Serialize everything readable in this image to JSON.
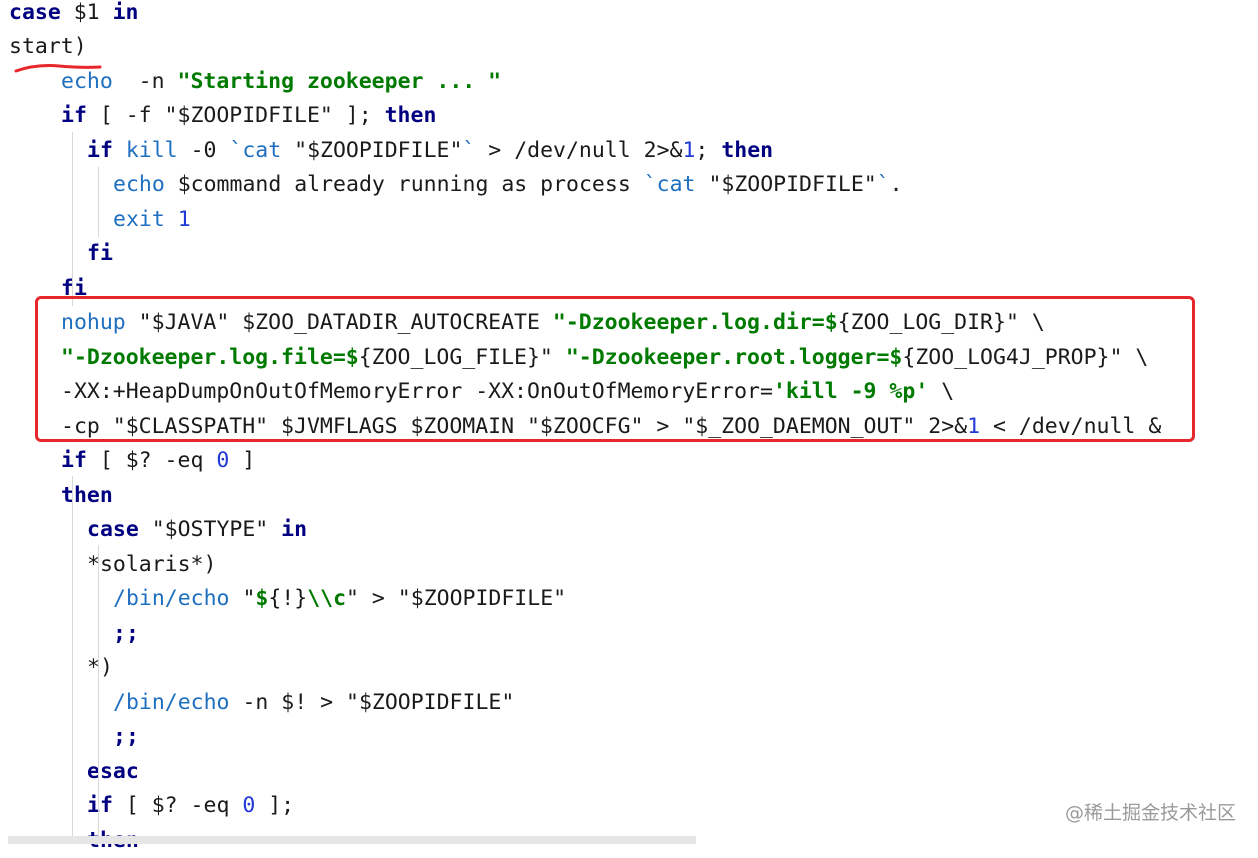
{
  "lines": [
    {
      "indent": 0,
      "tokens": [
        {
          "t": "case",
          "c": "kw"
        },
        {
          "t": " $1 "
        },
        {
          "t": "in",
          "c": "kw"
        }
      ]
    },
    {
      "indent": 0,
      "tokens": [
        {
          "t": "start)"
        }
      ]
    },
    {
      "indent": 2,
      "tokens": [
        {
          "t": "echo",
          "c": "cmd"
        },
        {
          "t": "  -n "
        },
        {
          "t": "\"Starting zookeeper ... \"",
          "c": "sb"
        }
      ]
    },
    {
      "indent": 2,
      "tokens": [
        {
          "t": "if",
          "c": "kw"
        },
        {
          "t": " [ -f \"$ZOOPIDFILE\" ]; "
        },
        {
          "t": "then",
          "c": "kw"
        }
      ]
    },
    {
      "indent": 3,
      "tokens": [
        {
          "t": "if",
          "c": "kw"
        },
        {
          "t": " "
        },
        {
          "t": "kill",
          "c": "cmd"
        },
        {
          "t": " -0 "
        },
        {
          "t": "`cat",
          "c": "cmd"
        },
        {
          "t": " \"$ZOOPIDFILE\""
        },
        {
          "t": "`",
          "c": "cmd"
        },
        {
          "t": " > /dev/null 2>&"
        },
        {
          "t": "1",
          "c": "num"
        },
        {
          "t": "; "
        },
        {
          "t": "then",
          "c": "kw"
        }
      ]
    },
    {
      "indent": 4,
      "tokens": [
        {
          "t": "echo",
          "c": "cmd"
        },
        {
          "t": " $command already running as process "
        },
        {
          "t": "`cat",
          "c": "cmd"
        },
        {
          "t": " \"$ZOOPIDFILE\""
        },
        {
          "t": "`",
          "c": "cmd"
        },
        {
          "t": "."
        }
      ]
    },
    {
      "indent": 4,
      "tokens": [
        {
          "t": "exit",
          "c": "cmd"
        },
        {
          "t": " "
        },
        {
          "t": "1",
          "c": "num"
        }
      ]
    },
    {
      "indent": 3,
      "tokens": [
        {
          "t": "fi",
          "c": "kw"
        }
      ]
    },
    {
      "indent": 2,
      "tokens": [
        {
          "t": "fi",
          "c": "kw"
        }
      ]
    },
    {
      "indent": 2,
      "tokens": [
        {
          "t": "nohup",
          "c": "cmd"
        },
        {
          "t": " \"$JAVA\" $ZOO_DATADIR_AUTOCREATE "
        },
        {
          "t": "\"-Dzookeeper.log.dir=$",
          "c": "sb"
        },
        {
          "t": "{ZOO_LOG_DIR}\" \\"
        }
      ]
    },
    {
      "indent": 2,
      "tokens": [
        {
          "t": "\"-Dzookeeper.log.file=$",
          "c": "sb"
        },
        {
          "t": "{ZOO_LOG_FILE}\" "
        },
        {
          "t": "\"-Dzookeeper.root.logger=$",
          "c": "sb"
        },
        {
          "t": "{ZOO_LOG4J_PROP}\" \\"
        }
      ]
    },
    {
      "indent": 2,
      "tokens": [
        {
          "t": "-XX:+HeapDumpOnOutOfMemoryError -XX:OnOutOfMemoryError="
        },
        {
          "t": "'kill -9 %p'",
          "c": "sb"
        },
        {
          "t": " \\"
        }
      ]
    },
    {
      "indent": 2,
      "tokens": [
        {
          "t": "-cp \"$CLASSPATH\" $JVMFLAGS $ZOOMAIN \"$ZOOCFG\" > \"$_ZOO_DAEMON_OUT\" 2>&"
        },
        {
          "t": "1",
          "c": "num"
        },
        {
          "t": " < /dev/null &"
        }
      ]
    },
    {
      "indent": 2,
      "tokens": [
        {
          "t": "if",
          "c": "kw"
        },
        {
          "t": " [ $? -eq "
        },
        {
          "t": "0",
          "c": "num"
        },
        {
          "t": " ]"
        }
      ]
    },
    {
      "indent": 2,
      "tokens": [
        {
          "t": "then",
          "c": "kw"
        }
      ]
    },
    {
      "indent": 3,
      "tokens": [
        {
          "t": "case",
          "c": "kw"
        },
        {
          "t": " \"$OSTYPE\" "
        },
        {
          "t": "in",
          "c": "kw"
        }
      ]
    },
    {
      "indent": 3,
      "tokens": [
        {
          "t": "*solaris*)"
        }
      ]
    },
    {
      "indent": 4,
      "tokens": [
        {
          "t": "/bin/echo",
          "c": "cmd"
        },
        {
          "t": " \""
        },
        {
          "t": "$",
          "c": "sb"
        },
        {
          "t": "{!}"
        },
        {
          "t": "\\\\c",
          "c": "sb"
        },
        {
          "t": "\" > \"$ZOOPIDFILE\""
        }
      ]
    },
    {
      "indent": 4,
      "tokens": [
        {
          "t": ";;",
          "c": "kw"
        }
      ]
    },
    {
      "indent": 3,
      "tokens": [
        {
          "t": "*)"
        }
      ]
    },
    {
      "indent": 4,
      "tokens": [
        {
          "t": "/bin/echo",
          "c": "cmd"
        },
        {
          "t": " -n $! > \"$ZOOPIDFILE\""
        }
      ]
    },
    {
      "indent": 4,
      "tokens": [
        {
          "t": ";;",
          "c": "kw"
        }
      ]
    },
    {
      "indent": 3,
      "tokens": [
        {
          "t": "esac",
          "c": "kw"
        }
      ]
    },
    {
      "indent": 3,
      "tokens": [
        {
          "t": "if",
          "c": "kw"
        },
        {
          "t": " [ $? -eq "
        },
        {
          "t": "0",
          "c": "num"
        },
        {
          "t": " ];"
        }
      ]
    },
    {
      "indent": 3,
      "tokens": [
        {
          "t": "then",
          "c": "kw"
        }
      ]
    }
  ],
  "annotations": {
    "highlight_box_color": "#e8262b",
    "underline_color": "#e8262b"
  },
  "watermark": "@稀土掘金技术社区"
}
